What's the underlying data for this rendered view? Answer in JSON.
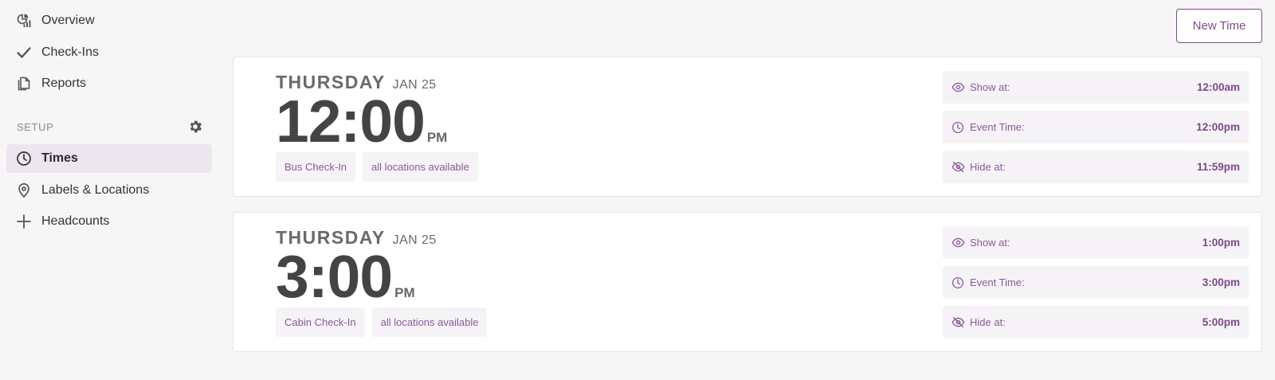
{
  "sidebar": {
    "items": [
      {
        "label": "Overview",
        "icon": "pie-chart-icon",
        "active": false
      },
      {
        "label": "Check-Ins",
        "icon": "check-icon",
        "active": false
      },
      {
        "label": "Reports",
        "icon": "reports-icon",
        "active": false
      }
    ],
    "setup_label": "SETUP",
    "setup_items": [
      {
        "label": "Times",
        "icon": "clock-icon",
        "active": true
      },
      {
        "label": "Labels & Locations",
        "icon": "map-pin-icon",
        "active": false
      },
      {
        "label": "Headcounts",
        "icon": "plus-icon",
        "active": false
      }
    ]
  },
  "header": {
    "new_time_label": "New Time"
  },
  "times": [
    {
      "day": "THURSDAY",
      "date": "JAN 25",
      "time": "12:00",
      "ampm": "PM",
      "tags": [
        "Bus Check-In",
        "all locations available"
      ],
      "show_label": "Show at:",
      "show_value": "12:00am",
      "event_label": "Event Time:",
      "event_value": "12:00pm",
      "hide_label": "Hide at:",
      "hide_value": "11:59pm"
    },
    {
      "day": "THURSDAY",
      "date": "JAN 25",
      "time": "3:00",
      "ampm": "PM",
      "tags": [
        "Cabin Check-In",
        "all locations available"
      ],
      "show_label": "Show at:",
      "show_value": "1:00pm",
      "event_label": "Event Time:",
      "event_value": "3:00pm",
      "hide_label": "Hide at:",
      "hide_value": "5:00pm"
    }
  ],
  "colors": {
    "accent": "#7c4a88",
    "active_bg": "#ece6ee",
    "pill_bg": "#f5f3f6",
    "page_bg": "#f7f6f7"
  }
}
